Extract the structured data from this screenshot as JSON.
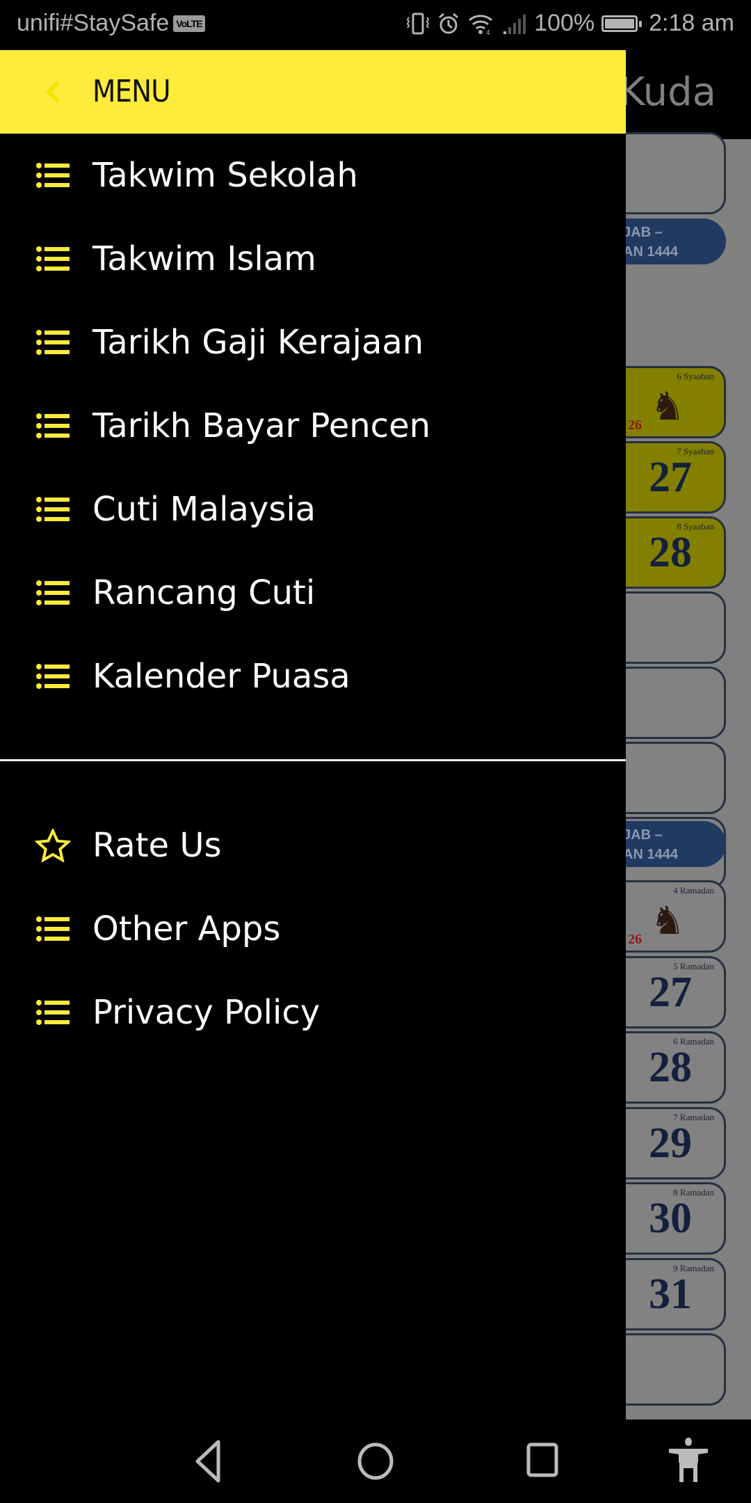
{
  "status_bar": {
    "carrier": "unifi#StaySafe",
    "volte_badge": "VoLTE",
    "icons": [
      "vibrate-icon",
      "alarm-icon",
      "wifi-icon",
      "signal-icon",
      "battery-icon"
    ],
    "battery": "100%",
    "time": "2:18 am"
  },
  "drawer": {
    "title": "MENU",
    "back_icon": "chevron-left-icon",
    "accent_color": "#ffeb3b",
    "primary_items": [
      {
        "label": "Takwim Sekolah",
        "icon": "list-icon"
      },
      {
        "label": "Takwim Islam",
        "icon": "list-icon"
      },
      {
        "label": "Tarikh Gaji Kerajaan",
        "icon": "list-icon"
      },
      {
        "label": "Tarikh Bayar Pencen",
        "icon": "list-icon"
      },
      {
        "label": "Cuti Malaysia",
        "icon": "list-icon"
      },
      {
        "label": "Rancang Cuti",
        "icon": "list-icon"
      },
      {
        "label": "Kalender Puasa",
        "icon": "list-icon"
      }
    ],
    "secondary_items": [
      {
        "label": "Rate Us",
        "icon": "star-icon"
      },
      {
        "label": "Other Apps",
        "icon": "list-icon"
      },
      {
        "label": "Privacy Policy",
        "icon": "list-icon"
      }
    ]
  },
  "background_app": {
    "title_fragment": "Kuda",
    "month_banners": [
      "JAB –\nAN 1444",
      "JAB –\nAN 1444"
    ],
    "cells_top": [
      {
        "hijri": "",
        "day": ""
      },
      {
        "hijri": "6 Syaaban",
        "day": "",
        "red_day": "26",
        "horse": true,
        "highlight": true
      },
      {
        "hijri": "7 Syaaban",
        "day": "27",
        "highlight": true
      },
      {
        "hijri": "8 Syaaban",
        "day": "28",
        "highlight": true
      },
      {
        "hijri": "",
        "day": ""
      },
      {
        "hijri": "",
        "day": ""
      },
      {
        "hijri": "",
        "day": ""
      },
      {
        "hijri": "",
        "day": ""
      }
    ],
    "cells_bottom": [
      {
        "hijri": "4 Ramadan",
        "day": "",
        "red_day": "26",
        "horse": true
      },
      {
        "hijri": "5 Ramadan",
        "day": "27"
      },
      {
        "hijri": "6 Ramadan",
        "day": "28"
      },
      {
        "hijri": "7 Ramadan",
        "day": "29"
      },
      {
        "hijri": "8 Ramadan",
        "day": "30"
      },
      {
        "hijri": "9 Ramadan",
        "day": "31"
      },
      {
        "hijri": "",
        "day": ""
      }
    ]
  },
  "nav_bar": {
    "buttons": [
      "back-icon",
      "home-icon",
      "recents-icon",
      "accessibility-icon"
    ]
  }
}
